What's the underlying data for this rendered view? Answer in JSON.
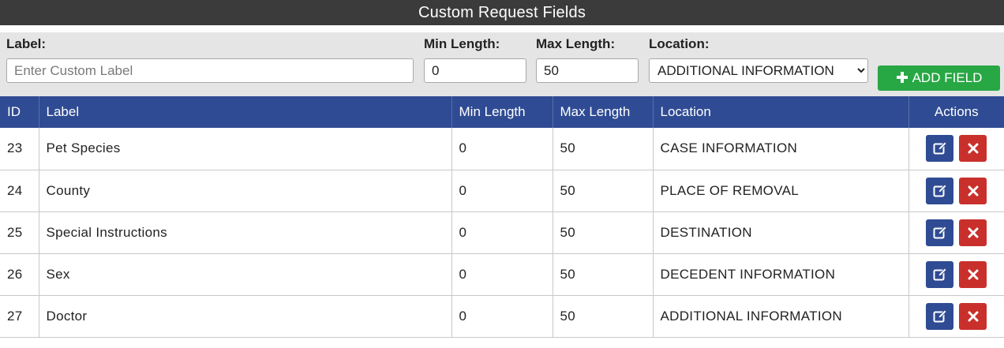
{
  "header": {
    "title": "Custom Request Fields"
  },
  "form": {
    "label": {
      "label": "Label:",
      "placeholder": "Enter Custom Label",
      "value": ""
    },
    "min_length": {
      "label": "Min Length:",
      "value": "0"
    },
    "max_length": {
      "label": "Max Length:",
      "value": "50"
    },
    "location": {
      "label": "Location:",
      "selected": "ADDITIONAL INFORMATION"
    },
    "add_button": "ADD FIELD"
  },
  "table": {
    "columns": [
      "ID",
      "Label",
      "Min Length",
      "Max Length",
      "Location",
      "Actions"
    ],
    "rows": [
      {
        "id": "23",
        "label": "Pet Species",
        "min": "0",
        "max": "50",
        "location": "CASE INFORMATION"
      },
      {
        "id": "24",
        "label": "County",
        "min": "0",
        "max": "50",
        "location": "PLACE OF REMOVAL"
      },
      {
        "id": "25",
        "label": "Special Instructions",
        "min": "0",
        "max": "50",
        "location": "DESTINATION"
      },
      {
        "id": "26",
        "label": "Sex",
        "min": "0",
        "max": "50",
        "location": "DECEDENT INFORMATION"
      },
      {
        "id": "27",
        "label": "Doctor",
        "min": "0",
        "max": "50",
        "location": "ADDITIONAL INFORMATION"
      }
    ]
  },
  "icons": {
    "add": "plus-icon",
    "edit": "edit-icon",
    "delete": "close-icon"
  },
  "colors": {
    "header_bg": "#2f4b93",
    "add_button": "#28a745",
    "delete_button": "#c9302c",
    "titlebar": "#3b3b3b"
  }
}
